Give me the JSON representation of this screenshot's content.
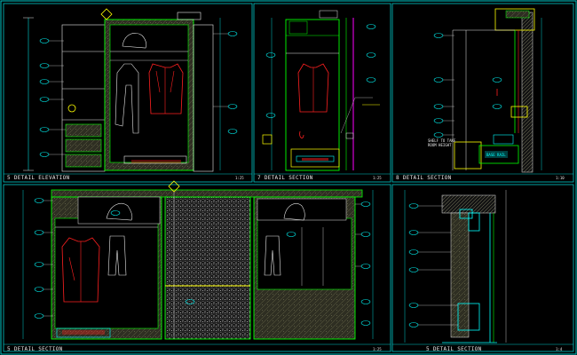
{
  "panels": [
    {
      "id": "p1",
      "title": "5 DETAIL ELEVATION",
      "scale": "1:25"
    },
    {
      "id": "p2",
      "title": "7 DETAIL SECTION",
      "scale": "1:25"
    },
    {
      "id": "p3",
      "title": "8 DETAIL SECTION",
      "scale": "1:10"
    },
    {
      "id": "p4",
      "title": "5 DETAIL SECTION",
      "scale": "1:25"
    },
    {
      "id": "p5",
      "title": "5 DETAIL SECTION",
      "scale": "1:4"
    }
  ],
  "labels": {
    "p3_note": "BASE RAIL",
    "p3_note2": "SHELF TO TAKE\nROOM HEIGHT"
  },
  "colors": {
    "frame": "#00c8c8",
    "green": "#00ff00",
    "yellow": "#ffff00",
    "red": "#ff2020",
    "cyan": "#00ffff",
    "magenta": "#ff00ff",
    "white": "#e8e8e8",
    "wood": "#3a3a28"
  }
}
